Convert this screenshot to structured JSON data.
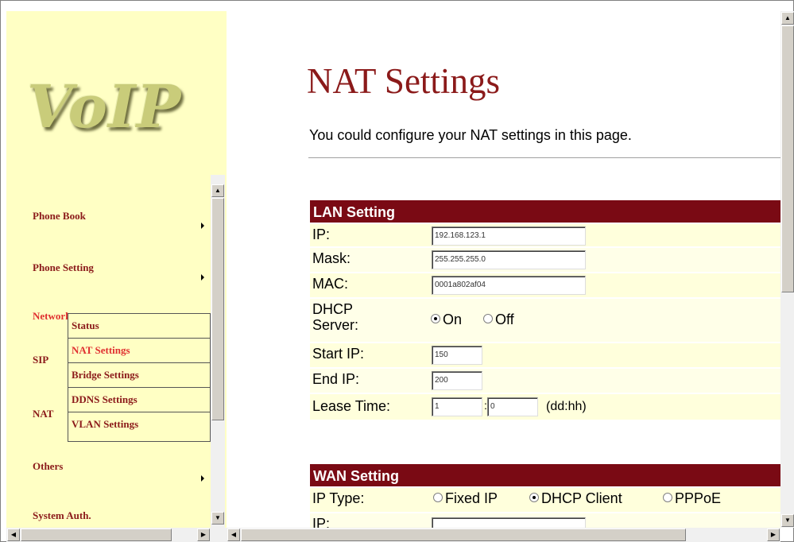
{
  "logo": {
    "text": "VoIP"
  },
  "nav": {
    "items": [
      {
        "label": "Phone Book"
      },
      {
        "label": "Phone Setting"
      },
      {
        "label": "Network"
      },
      {
        "label": "SIP"
      },
      {
        "label": "NAT"
      },
      {
        "label": "Others"
      },
      {
        "label": "System Auth."
      }
    ],
    "submenu": [
      {
        "label": "Status"
      },
      {
        "label": "NAT Settings"
      },
      {
        "label": "Bridge Settings"
      },
      {
        "label": "DDNS Settings"
      },
      {
        "label": "VLAN Settings"
      }
    ]
  },
  "page": {
    "title": "NAT Settings",
    "subtitle": "You could configure your NAT settings in this page."
  },
  "lan": {
    "header": "LAN Setting",
    "ip_label": "IP:",
    "ip_value": "192.168.123.1",
    "mask_label": "Mask:",
    "mask_value": "255.255.255.0",
    "mac_label": "MAC:",
    "mac_value": "0001a802af04",
    "dhcp_label": "DHCP Server:",
    "dhcp_on": "On",
    "dhcp_off": "Off",
    "start_label": "Start IP:",
    "start_value": "150",
    "end_label": "End IP:",
    "end_value": "200",
    "lease_label": "Lease Time:",
    "lease_dd": "1",
    "lease_hh": "0",
    "lease_sep": ":",
    "lease_unit": "(dd:hh)"
  },
  "wan": {
    "header": "WAN Setting",
    "type_label": "IP Type:",
    "opt_fixed": "Fixed IP",
    "opt_dhcp": "DHCP Client",
    "opt_pppoe": "PPPoE",
    "selected": "DHCP Client",
    "ip_label": "IP:"
  },
  "colors": {
    "accent": "#8b1a1a",
    "header_bg": "#7a0a14",
    "nav_bg": "#ffffc4"
  }
}
